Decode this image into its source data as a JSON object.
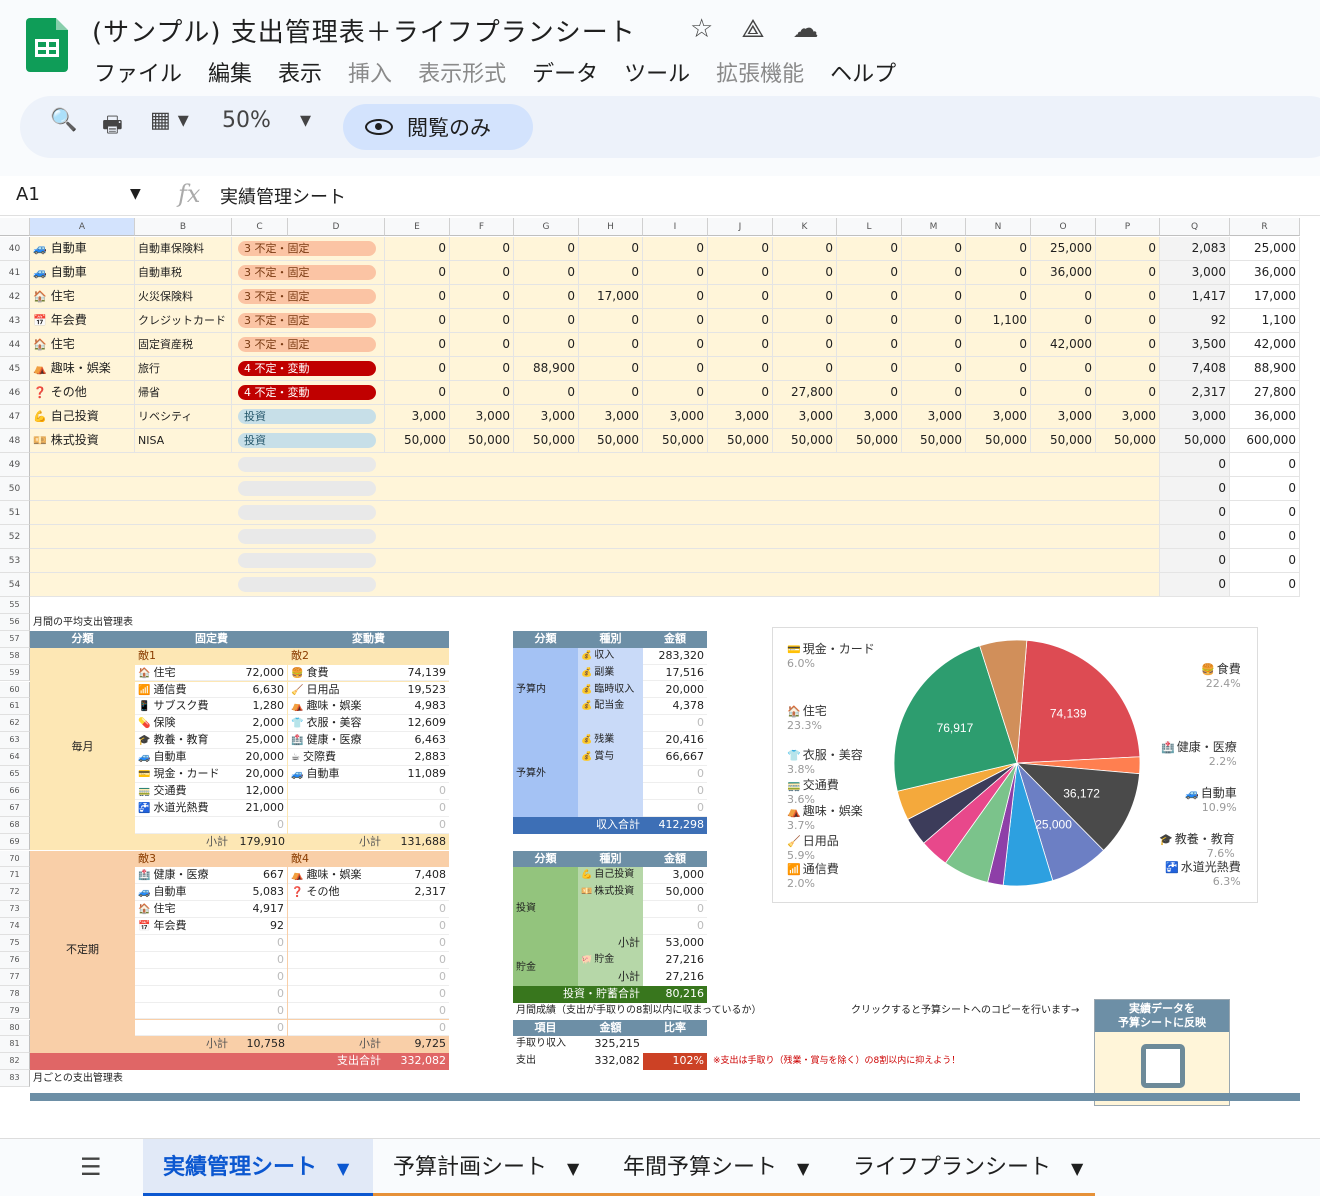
{
  "doc": {
    "title": "(サンプル) 支出管理表＋ライフプランシート",
    "menu": [
      "ファイル",
      "編集",
      "表示",
      "挿入",
      "表示形式",
      "データ",
      "ツール",
      "拡張機能",
      "ヘルプ"
    ],
    "menu_disabled": [
      3,
      4,
      7
    ],
    "zoom": "50%",
    "view_only": "閲覧のみ",
    "name_box": "A1",
    "formula": "実績管理シート"
  },
  "col_headers": [
    "A",
    "B",
    "C",
    "D",
    "E",
    "F",
    "G",
    "H",
    "I",
    "J",
    "K",
    "L",
    "M",
    "N",
    "O",
    "P",
    "Q",
    "R"
  ],
  "top_rows": [
    {
      "n": "40",
      "icon": "🚙",
      "cat": "自動車",
      "item": "自動車保険料",
      "type": "3 不定・固定",
      "kind": "p3",
      "vals": [
        "0",
        "0",
        "0",
        "0",
        "0",
        "0",
        "0",
        "0",
        "0",
        "0",
        "25,000",
        "0"
      ],
      "q": "2,083",
      "r": "25,000"
    },
    {
      "n": "41",
      "icon": "🚙",
      "cat": "自動車",
      "item": "自動車税",
      "type": "3 不定・固定",
      "kind": "p3",
      "vals": [
        "0",
        "0",
        "0",
        "0",
        "0",
        "0",
        "0",
        "0",
        "0",
        "0",
        "36,000",
        "0"
      ],
      "q": "3,000",
      "r": "36,000"
    },
    {
      "n": "42",
      "icon": "🏠",
      "cat": "住宅",
      "item": "火災保険料",
      "type": "3 不定・固定",
      "kind": "p3",
      "vals": [
        "0",
        "0",
        "0",
        "17,000",
        "0",
        "0",
        "0",
        "0",
        "0",
        "0",
        "0",
        "0"
      ],
      "q": "1,417",
      "r": "17,000"
    },
    {
      "n": "43",
      "icon": "📅",
      "cat": "年会費",
      "item": "クレジットカード",
      "type": "3 不定・固定",
      "kind": "p3",
      "vals": [
        "0",
        "0",
        "0",
        "0",
        "0",
        "0",
        "0",
        "0",
        "0",
        "1,100",
        "0",
        "0"
      ],
      "q": "92",
      "r": "1,100"
    },
    {
      "n": "44",
      "icon": "🏠",
      "cat": "住宅",
      "item": "固定資産税",
      "type": "3 不定・固定",
      "kind": "p3",
      "vals": [
        "0",
        "0",
        "0",
        "0",
        "0",
        "0",
        "0",
        "0",
        "0",
        "0",
        "42,000",
        "0"
      ],
      "q": "3,500",
      "r": "42,000"
    },
    {
      "n": "45",
      "icon": "⛺",
      "cat": "趣味・娯楽",
      "item": "旅行",
      "type": "4 不定・変動",
      "kind": "p4",
      "vals": [
        "0",
        "0",
        "88,900",
        "0",
        "0",
        "0",
        "0",
        "0",
        "0",
        "0",
        "0",
        "0"
      ],
      "q": "7,408",
      "r": "88,900"
    },
    {
      "n": "46",
      "icon": "❓",
      "cat": "その他",
      "item": "帰省",
      "type": "4 不定・変動",
      "kind": "p4",
      "vals": [
        "0",
        "0",
        "0",
        "0",
        "0",
        "0",
        "27,800",
        "0",
        "0",
        "0",
        "0",
        "0"
      ],
      "q": "2,317",
      "r": "27,800"
    },
    {
      "n": "47",
      "icon": "💪",
      "cat": "自己投資",
      "item": "リベシティ",
      "type": "投資",
      "kind": "pi",
      "vals": [
        "3,000",
        "3,000",
        "3,000",
        "3,000",
        "3,000",
        "3,000",
        "3,000",
        "3,000",
        "3,000",
        "3,000",
        "3,000",
        "3,000"
      ],
      "q": "3,000",
      "r": "36,000"
    },
    {
      "n": "48",
      "icon": "💴",
      "cat": "株式投資",
      "item": "NISA",
      "type": "投資",
      "kind": "pi",
      "vals": [
        "50,000",
        "50,000",
        "50,000",
        "50,000",
        "50,000",
        "50,000",
        "50,000",
        "50,000",
        "50,000",
        "50,000",
        "50,000",
        "50,000"
      ],
      "q": "50,000",
      "r": "600,000"
    }
  ],
  "empty_rows": {
    "numbers": [
      "49",
      "50",
      "51",
      "52",
      "53",
      "54"
    ],
    "q": "0",
    "r": "0"
  },
  "lower_row_numbers": [
    "55",
    "56",
    "57",
    "58",
    "59",
    "60",
    "61",
    "62",
    "63",
    "64",
    "65",
    "66",
    "67",
    "68",
    "69",
    "70",
    "71",
    "72",
    "73",
    "74",
    "75",
    "76",
    "77",
    "78",
    "79",
    "80",
    "81",
    "82",
    "83"
  ],
  "summary": {
    "title": "月間の平均支出管理表",
    "headers": {
      "group": "分類",
      "fixed": "固定費",
      "variable": "変動費"
    },
    "monthly_label": "毎月",
    "irregular_label": "不定期",
    "s1": "敵1",
    "s2": "敵2",
    "s3": "敵3",
    "s4": "敵4",
    "monthly_fixed": [
      {
        "i": "🏠",
        "l": "住宅",
        "v": "72,000"
      },
      {
        "i": "📶",
        "l": "通信費",
        "v": "6,630"
      },
      {
        "i": "📱",
        "l": "サブスク費",
        "v": "1,280"
      },
      {
        "i": "💊",
        "l": "保険",
        "v": "2,000"
      },
      {
        "i": "🎓",
        "l": "教養・教育",
        "v": "25,000"
      },
      {
        "i": "🚙",
        "l": "自動車",
        "v": "20,000"
      },
      {
        "i": "💳",
        "l": "現金・カード",
        "v": "20,000"
      },
      {
        "i": "🚃",
        "l": "交通費",
        "v": "12,000"
      },
      {
        "i": "🚰",
        "l": "水道光熱費",
        "v": "21,000"
      },
      {
        "i": "",
        "l": "",
        "v": "0"
      }
    ],
    "monthly_var": [
      {
        "i": "🍔",
        "l": "食費",
        "v": "74,139"
      },
      {
        "i": "🧹",
        "l": "日用品",
        "v": "19,523"
      },
      {
        "i": "⛺",
        "l": "趣味・娯楽",
        "v": "4,983"
      },
      {
        "i": "👕",
        "l": "衣服・美容",
        "v": "12,609"
      },
      {
        "i": "🏥",
        "l": "健康・医療",
        "v": "6,463"
      },
      {
        "i": "☕",
        "l": "交際費",
        "v": "2,883"
      },
      {
        "i": "🚙",
        "l": "自動車",
        "v": "11,089"
      },
      {
        "i": "",
        "l": "",
        "v": "0"
      },
      {
        "i": "",
        "l": "",
        "v": "0"
      },
      {
        "i": "",
        "l": "",
        "v": "0"
      }
    ],
    "subtotal_label": "小計",
    "monthly_fixed_sub": "179,910",
    "monthly_var_sub": "131,688",
    "irr_fixed": [
      {
        "i": "🏥",
        "l": "健康・医療",
        "v": "667"
      },
      {
        "i": "🚙",
        "l": "自動車",
        "v": "5,083"
      },
      {
        "i": "🏠",
        "l": "住宅",
        "v": "4,917"
      },
      {
        "i": "📅",
        "l": "年会費",
        "v": "92"
      },
      {
        "i": "",
        "l": "",
        "v": "0"
      },
      {
        "i": "",
        "l": "",
        "v": "0"
      },
      {
        "i": "",
        "l": "",
        "v": "0"
      },
      {
        "i": "",
        "l": "",
        "v": "0"
      },
      {
        "i": "",
        "l": "",
        "v": "0"
      },
      {
        "i": "",
        "l": "",
        "v": "0"
      }
    ],
    "irr_var": [
      {
        "i": "⛺",
        "l": "趣味・娯楽",
        "v": "7,408"
      },
      {
        "i": "❓",
        "l": "その他",
        "v": "2,317"
      },
      {
        "i": "",
        "l": "",
        "v": "0"
      },
      {
        "i": "",
        "l": "",
        "v": "0"
      },
      {
        "i": "",
        "l": "",
        "v": "0"
      },
      {
        "i": "",
        "l": "",
        "v": "0"
      },
      {
        "i": "",
        "l": "",
        "v": "0"
      },
      {
        "i": "",
        "l": "",
        "v": "0"
      },
      {
        "i": "",
        "l": "",
        "v": "0"
      },
      {
        "i": "",
        "l": "",
        "v": "0"
      }
    ],
    "irr_fixed_sub": "10,758",
    "irr_var_sub": "9,725",
    "total_label": "支出合計",
    "total": "332,082"
  },
  "income": {
    "headers": [
      "分類",
      "種別",
      "金額"
    ],
    "budget_in": "予算内",
    "budget_out": "予算外",
    "rows_in": [
      {
        "i": "💰",
        "l": "収入",
        "v": "283,320"
      },
      {
        "i": "💰",
        "l": "副業",
        "v": "17,516"
      },
      {
        "i": "💰",
        "l": "臨時収入",
        "v": "20,000"
      },
      {
        "i": "💰",
        "l": "配当金",
        "v": "4,378"
      },
      {
        "i": "",
        "l": "",
        "v": "0"
      }
    ],
    "rows_out": [
      {
        "i": "💰",
        "l": "残業",
        "v": "20,416"
      },
      {
        "i": "💰",
        "l": "賞与",
        "v": "66,667"
      },
      {
        "i": "",
        "l": "",
        "v": "0"
      },
      {
        "i": "",
        "l": "",
        "v": "0"
      },
      {
        "i": "",
        "l": "",
        "v": "0"
      }
    ],
    "total_label": "収入合計",
    "total": "412,298"
  },
  "invest": {
    "headers": [
      "分類",
      "種別",
      "金額"
    ],
    "invest_label": "投資",
    "save_label": "貯金",
    "rows_inv": [
      {
        "i": "💪",
        "l": "自己投資",
        "v": "3,000"
      },
      {
        "i": "💴",
        "l": "株式投資",
        "v": "50,000"
      },
      {
        "i": "",
        "l": "",
        "v": "0"
      },
      {
        "i": "",
        "l": "",
        "v": "0"
      }
    ],
    "inv_sub": "53,000",
    "save_row": {
      "i": "🐖",
      "l": "貯金",
      "v": "27,216"
    },
    "save_sub": "27,216",
    "subtotal_label": "小計",
    "total_label": "投資・貯蓄合計",
    "total": "80,216"
  },
  "results": {
    "title": "月間成績（支出が手取りの8割以内に収まっているか）",
    "headers": [
      "項目",
      "金額",
      "比率"
    ],
    "take_home_label": "手取り収入",
    "take_home": "325,215",
    "spend_label": "支出",
    "spend": "332,082",
    "ratio": "102%",
    "note": "※支出は手取り（残業・賞与を除く）の8割以内に抑えよう！",
    "copy_hint": "クリックすると予算シートへのコピーを行います→"
  },
  "reflect_button": {
    "line1": "実績データを",
    "line2": "予算シートに反映"
  },
  "monthly_title": "月ごとの支出管理表",
  "chart_data": {
    "type": "pie",
    "slices": [
      {
        "name": "食費",
        "value": 74139,
        "pct": "22.4%",
        "icon": "🍔",
        "color": "#dd4b53"
      },
      {
        "name": "健康・医療",
        "value": 7130,
        "pct": "2.2%",
        "icon": "🏥",
        "color": "#ff7f50"
      },
      {
        "name": "自動車",
        "value": 36172,
        "pct": "10.9%",
        "icon": "🚙",
        "color": "#4a4a4a"
      },
      {
        "name": "教養・教育",
        "value": 25000,
        "pct": "7.6%",
        "icon": "🎓",
        "color": "#6c7fc4"
      },
      {
        "name": "水道光熱費",
        "value": 21000,
        "pct": "6.3%",
        "icon": "🚰",
        "color": "#2da0e0"
      },
      {
        "name": "通信費",
        "value": 6630,
        "pct": "2.0%",
        "icon": "📶",
        "color": "#8e3fa8"
      },
      {
        "name": "日用品",
        "value": 19523,
        "pct": "5.9%",
        "icon": "🧹",
        "color": "#7bc38b"
      },
      {
        "name": "趣味・娯楽",
        "value": 12391,
        "pct": "3.7%",
        "icon": "⛺",
        "color": "#e8488b"
      },
      {
        "name": "交通費",
        "value": 12000,
        "pct": "3.6%",
        "icon": "🚃",
        "color": "#3c3c5a"
      },
      {
        "name": "衣服・美容",
        "value": 12609,
        "pct": "3.8%",
        "icon": "👕",
        "color": "#f4a93c"
      },
      {
        "name": "住宅",
        "value": 76917,
        "pct": "23.3%",
        "icon": "🏠",
        "color": "#2d9d6f"
      },
      {
        "name": "現金・カード",
        "value": 20000,
        "pct": "6.0%",
        "icon": "💳",
        "color": "#d18f5a"
      }
    ],
    "data_labels": [
      "74,139",
      "36,172",
      "25,000",
      "76,917"
    ]
  },
  "sheet_tabs": [
    "実績管理シート",
    "予算計画シート",
    "年間予算シート",
    "ライフプランシート"
  ]
}
